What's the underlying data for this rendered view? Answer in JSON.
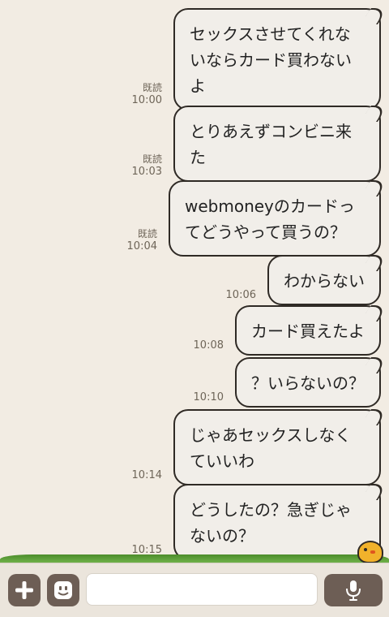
{
  "messages": [
    {
      "text": "セックスさせてくれないならカード買わないよ",
      "read": "既読",
      "time": "10:00"
    },
    {
      "text": "とりあえずコンビニ来た",
      "read": "既読",
      "time": "10:03"
    },
    {
      "text": "webmoneyのカードってどうやって買うの？",
      "read": "既読",
      "time": "10:04"
    },
    {
      "text": "わからない",
      "read": "",
      "time": "10:06"
    },
    {
      "text": "カード買えたよ",
      "read": "",
      "time": "10:08"
    },
    {
      "text": "？いらないの？",
      "read": "",
      "time": "10:10"
    },
    {
      "text": "じゃあセックスしなくていいわ",
      "read": "",
      "time": "10:14"
    },
    {
      "text": "どうしたの？急ぎじゃないの？",
      "read": "",
      "time": "10:15"
    }
  ],
  "composer": {
    "placeholder": ""
  },
  "icons": {
    "add": "plus-icon",
    "sticker": "smiley-icon",
    "voice": "microphone-icon"
  }
}
